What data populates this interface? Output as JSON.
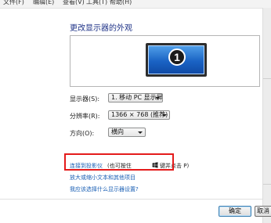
{
  "menu": {
    "items": [
      "文件(F)",
      "编辑(E)",
      "查看(V)",
      "工具(T)",
      "帮助(H)"
    ]
  },
  "page": {
    "title": "更改显示器的外观",
    "monitor_number": "1"
  },
  "settings": {
    "display_label": "显示器(S):",
    "display_value": "1. 移动 PC 显示屏",
    "resolution_label": "分辨率(R):",
    "resolution_value": "1366 × 768 (推荐)",
    "orientation_label": "方向(O):",
    "orientation_value": "横向"
  },
  "links": {
    "projector": "连接到投影仪",
    "projector_hint_prefix": "(也可按住",
    "projector_hint_suffix": "键并点击 P)",
    "text_size": "放大或缩小文本和其他项目",
    "which_settings": "我应该选择什么显示器设置?"
  },
  "buttons": {
    "ok": "确定",
    "cancel": "取消"
  },
  "colors": {
    "highlight_box": "#e41b1b",
    "link": "#1a5fb4",
    "title": "#1e3287"
  }
}
